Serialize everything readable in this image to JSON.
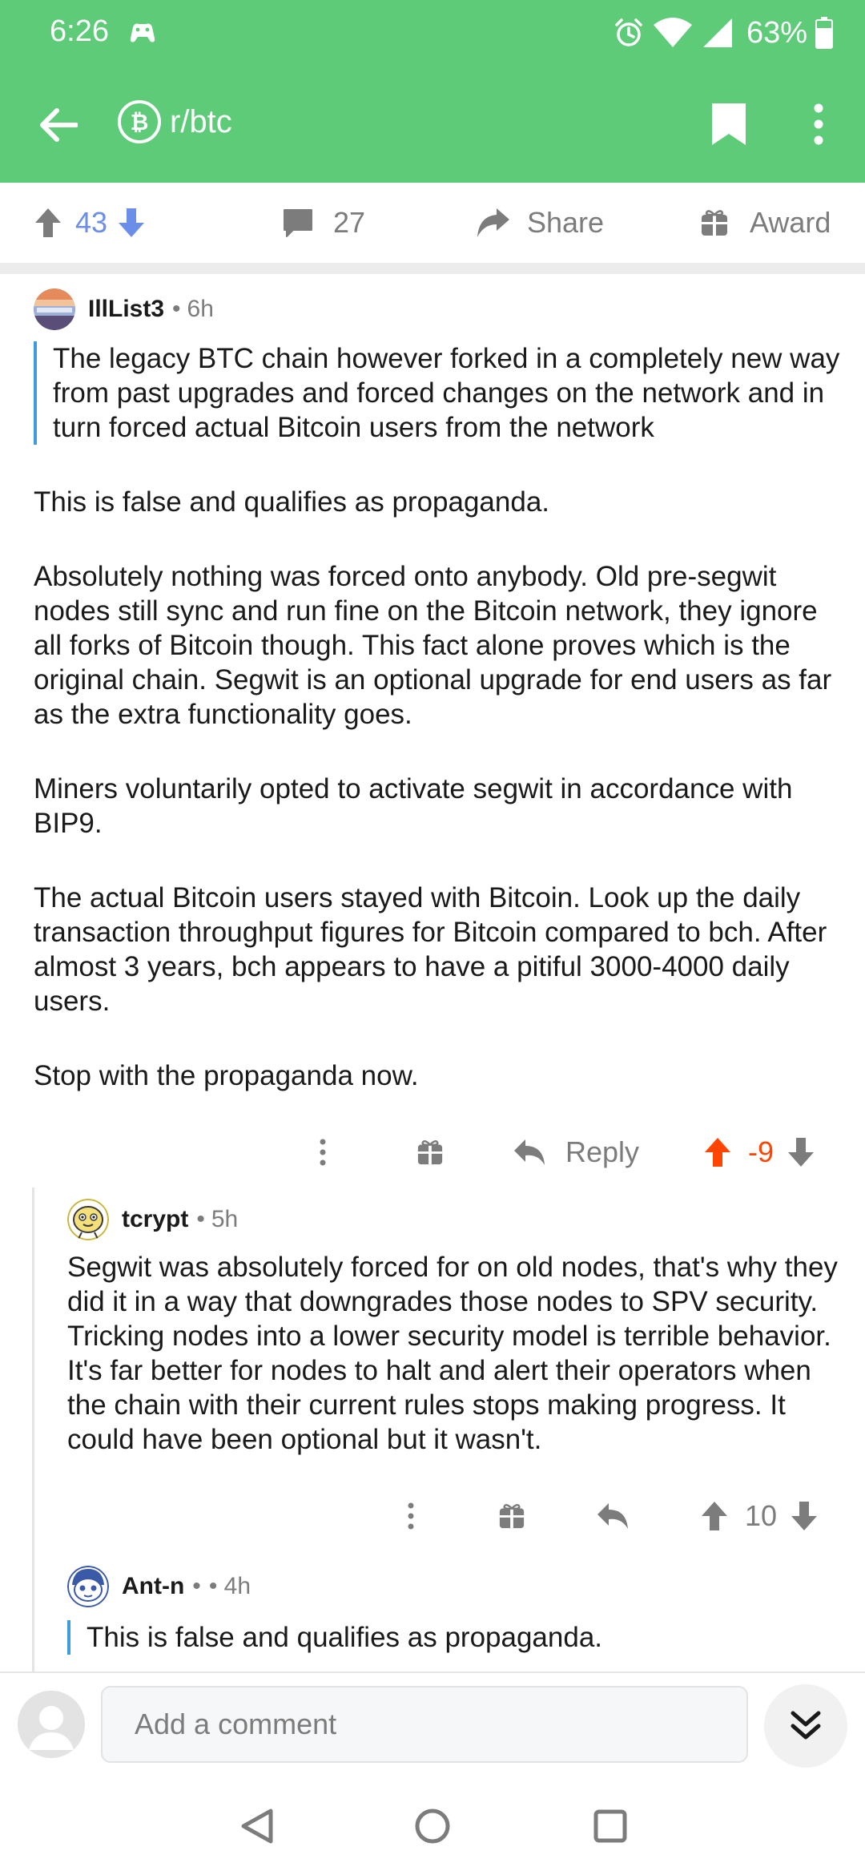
{
  "status_bar": {
    "time": "6:26",
    "battery": "63%"
  },
  "app_bar": {
    "subreddit": "r/btc"
  },
  "post_actions": {
    "vote_count": "43",
    "comment_count": "27",
    "share_label": "Share",
    "award_label": "Award"
  },
  "comments": [
    {
      "username": "IllList3",
      "age": "6h",
      "quote": "The legacy BTC chain however forked in a completely new way from past upgrades and forced changes on the network and in turn forced actual Bitcoin users from the network",
      "paragraphs": [
        "This is false and qualifies as propaganda.",
        "Absolutely nothing was forced onto anybody.  Old pre-segwit nodes still sync and run fine on the Bitcoin network, they ignore all forks of Bitcoin though.  This fact alone proves which is the original chain.  Segwit is an optional upgrade for end users as far as the extra functionality goes.",
        "Miners voluntarily opted to activate segwit in accordance with BIP9.",
        "The actual Bitcoin users stayed with Bitcoin.  Look up the daily transaction throughput figures for Bitcoin compared to bch.  After almost 3 years, bch appears to have a pitiful 3000-4000 daily users.",
        "Stop with the propaganda now."
      ],
      "reply_label": "Reply",
      "score": "-9"
    },
    {
      "username": "tcrypt",
      "age": "5h",
      "body": "Segwit was absolutely forced for on old nodes, that's why they did it in a way that downgrades those nodes to SPV security. Tricking nodes into a lower security model is terrible behavior. It's far better for nodes to halt and alert their operators when the chain with their current rules stops making progress. It could have been optional but it wasn't.",
      "score": "10"
    },
    {
      "username": "Ant-n",
      "age": "• 4h",
      "quote": "This is false and qualifies as propaganda."
    }
  ],
  "input_bar": {
    "placeholder": "Add a comment"
  },
  "colors": {
    "header_green": "#5ecb79",
    "upvote_blue": "#6b8fe8",
    "upvoted_orange": "#ff4500",
    "quote_bar": "#3e9bdc"
  }
}
